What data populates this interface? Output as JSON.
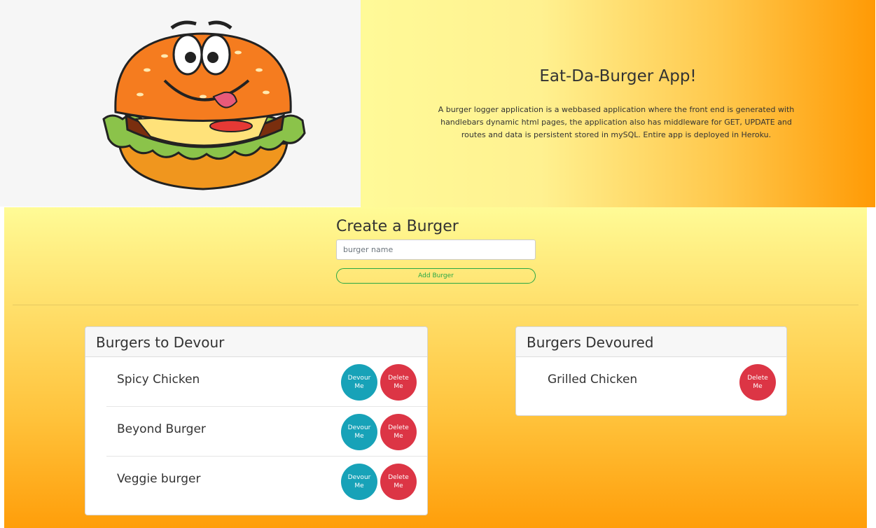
{
  "header": {
    "title": "Eat-Da-Burger App!",
    "description": "A burger logger application is a webbased application where the front end is generated with handlebars dynamic html pages, the application also has middleware for GET, UPDATE and routes and data is persistent stored in mySQL. Entire app is deployed in Heroku."
  },
  "create": {
    "heading": "Create a Burger",
    "input_placeholder": "burger name",
    "input_value": "",
    "add_button": "Add Burger"
  },
  "to_devour": {
    "heading": "Burgers to Devour",
    "items": [
      {
        "name": "Spicy Chicken"
      },
      {
        "name": "Beyond Burger"
      },
      {
        "name": "Veggie burger"
      }
    ]
  },
  "devoured": {
    "heading": "Burgers Devoured",
    "items": [
      {
        "name": "Grilled Chicken"
      }
    ]
  },
  "buttons": {
    "devour_line1": "Devour",
    "devour_line2": "Me",
    "delete_line1": "Delete",
    "delete_line2": "Me"
  },
  "colors": {
    "devour": "#17a2b8",
    "delete": "#dc3545",
    "add": "#28a745"
  }
}
